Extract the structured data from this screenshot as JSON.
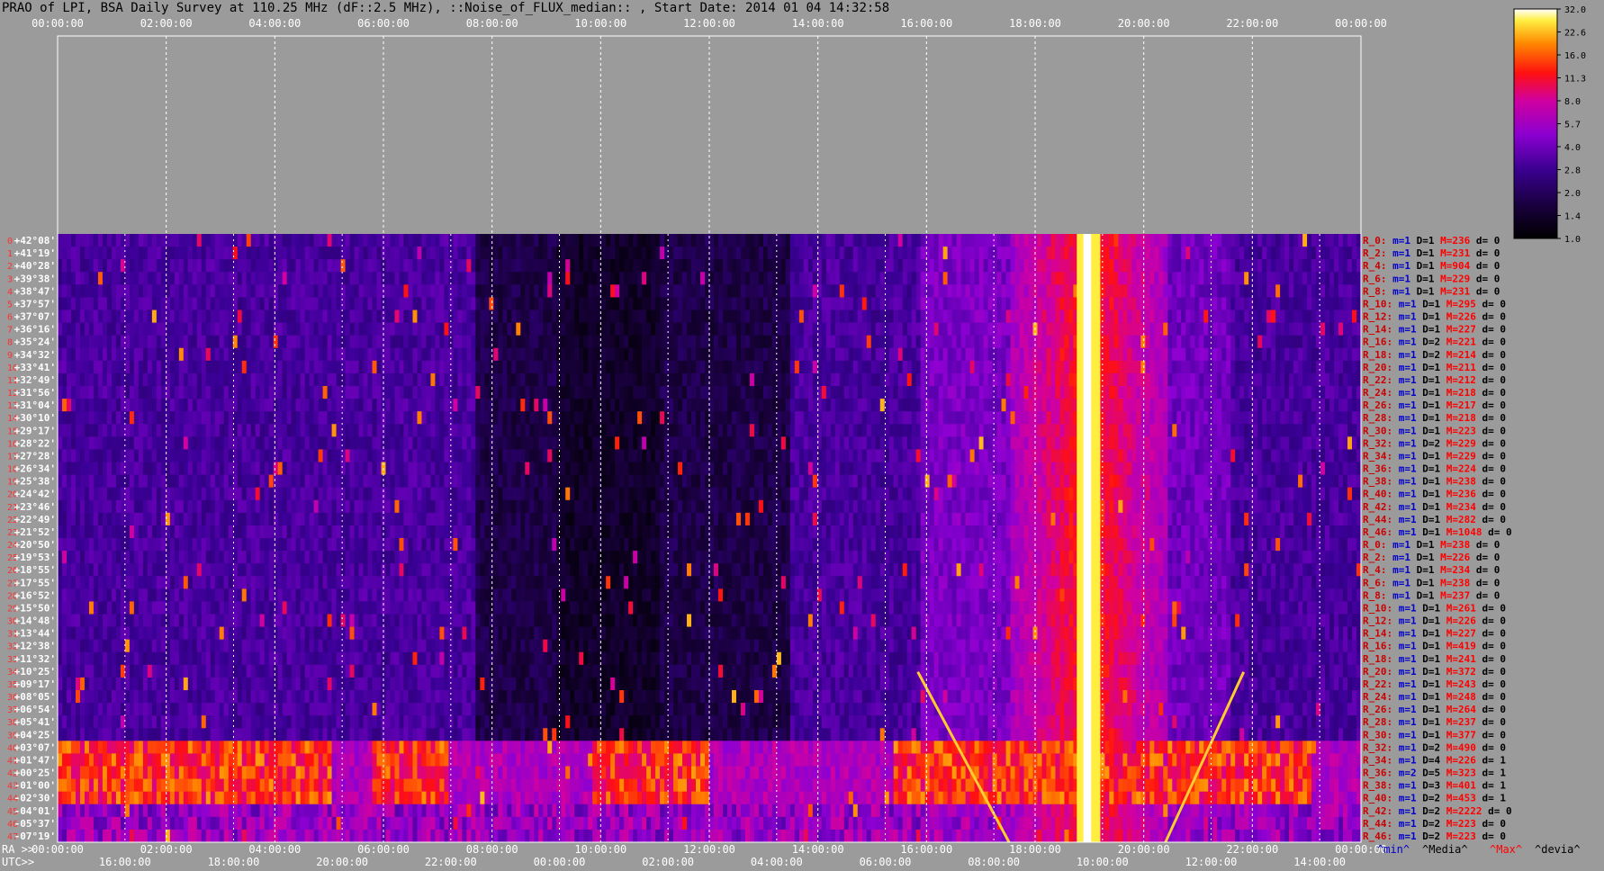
{
  "title": "PRAO of LPI, BSA Daily Survey at 110.25 MHz (dF::2.5 MHz), ::Noise_of_FLUX_median:: , Start Date: 2014 01 04 14:32:58",
  "chart_data": {
    "type": "heatmap",
    "title": "PRAO of LPI, BSA Daily Survey at 110.25 MHz (dF::2.5 MHz), ::Noise_of_FLUX_median:: , Start Date: 2014 01 04 14:32:58",
    "top_axis_ticks": [
      "00:00:00",
      "02:00:00",
      "04:00:00",
      "06:00:00",
      "08:00:00",
      "10:00:00",
      "12:00:00",
      "14:00:00",
      "16:00:00",
      "18:00:00",
      "20:00:00",
      "22:00:00",
      "00:00:00"
    ],
    "ra_axis_label": "RA >>",
    "ra_ticks": [
      "00:00:00",
      "02:00:00",
      "04:00:00",
      "06:00:00",
      "08:00:00",
      "10:00:00",
      "12:00:00",
      "14:00:00",
      "16:00:00",
      "18:00:00",
      "20:00:00",
      "22:00:00",
      "00:00:00"
    ],
    "utc_axis_label": "UTC>>",
    "utc_ticks": [
      "16:00:00",
      "18:00:00",
      "20:00:00",
      "22:00:00",
      "00:00:00",
      "02:00:00",
      "04:00:00",
      "06:00:00",
      "08:00:00",
      "10:00:00",
      "12:00:00",
      "14:00:00"
    ],
    "declinations": [
      "+42°08'",
      "+41°19'",
      "+40°28'",
      "+39°38'",
      "+38°47'",
      "+37°57'",
      "+37°07'",
      "+36°16'",
      "+35°24'",
      "+34°32'",
      "+33°41'",
      "+32°49'",
      "+31°56'",
      "+31°04'",
      "+30°10'",
      "+29°17'",
      "+28°22'",
      "+27°28'",
      "+26°34'",
      "+25°38'",
      "+24°42'",
      "+23°46'",
      "+22°49'",
      "+21°52'",
      "+20°50'",
      "+19°53'",
      "+18°55'",
      "+17°55'",
      "+16°52'",
      "+15°50'",
      "+14°48'",
      "+13°44'",
      "+12°38'",
      "+11°32'",
      "+10°25'",
      "+09°17'",
      "+08°05'",
      "+06°54'",
      "+05°41'",
      "+04°25'",
      "+03°07'",
      "+01°47'",
      "+00°25'",
      "-01°00'",
      "-02°30'",
      "-04°01'",
      "-05°37'",
      "-07°19'"
    ],
    "colorbar_ticks": [
      "32.0",
      "22.6",
      "16.0",
      "11.3",
      "8.0",
      "5.7",
      "4.0",
      "2.8",
      "2.0",
      "1.4",
      "1.0"
    ],
    "beam_stats": [
      {
        "r": "R_0:",
        "m": "m=1",
        "d": "D=1",
        "M": "M=236",
        "dv": "d= 0"
      },
      {
        "r": "R_2:",
        "m": "m=1",
        "d": "D=1",
        "M": "M=231",
        "dv": "d= 0"
      },
      {
        "r": "R_4:",
        "m": "m=1",
        "d": "D=1",
        "M": "M=904",
        "dv": "d= 0"
      },
      {
        "r": "R_6:",
        "m": "m=1",
        "d": "D=1",
        "M": "M=229",
        "dv": "d= 0"
      },
      {
        "r": "R_8:",
        "m": "m=1",
        "d": "D=1",
        "M": "M=231",
        "dv": "d= 0"
      },
      {
        "r": "R_10:",
        "m": "m=1",
        "d": "D=1",
        "M": "M=295",
        "dv": "d= 0"
      },
      {
        "r": "R_12:",
        "m": "m=1",
        "d": "D=1",
        "M": "M=226",
        "dv": "d= 0"
      },
      {
        "r": "R_14:",
        "m": "m=1",
        "d": "D=1",
        "M": "M=227",
        "dv": "d= 0"
      },
      {
        "r": "R_16:",
        "m": "m=1",
        "d": "D=2",
        "M": "M=221",
        "dv": "d= 0"
      },
      {
        "r": "R_18:",
        "m": "m=1",
        "d": "D=2",
        "M": "M=214",
        "dv": "d= 0"
      },
      {
        "r": "R_20:",
        "m": "m=1",
        "d": "D=1",
        "M": "M=211",
        "dv": "d= 0"
      },
      {
        "r": "R_22:",
        "m": "m=1",
        "d": "D=1",
        "M": "M=212",
        "dv": "d= 0"
      },
      {
        "r": "R_24:",
        "m": "m=1",
        "d": "D=1",
        "M": "M=218",
        "dv": "d= 0"
      },
      {
        "r": "R_26:",
        "m": "m=1",
        "d": "D=1",
        "M": "M=217",
        "dv": "d= 0"
      },
      {
        "r": "R_28:",
        "m": "m=1",
        "d": "D=1",
        "M": "M=218",
        "dv": "d= 0"
      },
      {
        "r": "R_30:",
        "m": "m=1",
        "d": "D=1",
        "M": "M=223",
        "dv": "d= 0"
      },
      {
        "r": "R_32:",
        "m": "m=1",
        "d": "D=2",
        "M": "M=229",
        "dv": "d= 0"
      },
      {
        "r": "R_34:",
        "m": "m=1",
        "d": "D=1",
        "M": "M=229",
        "dv": "d= 0"
      },
      {
        "r": "R_36:",
        "m": "m=1",
        "d": "D=1",
        "M": "M=224",
        "dv": "d= 0"
      },
      {
        "r": "R_38:",
        "m": "m=1",
        "d": "D=1",
        "M": "M=238",
        "dv": "d= 0"
      },
      {
        "r": "R_40:",
        "m": "m=1",
        "d": "D=1",
        "M": "M=236",
        "dv": "d= 0"
      },
      {
        "r": "R_42:",
        "m": "m=1",
        "d": "D=1",
        "M": "M=234",
        "dv": "d= 0"
      },
      {
        "r": "R_44:",
        "m": "m=1",
        "d": "D=1",
        "M": "M=282",
        "dv": "d= 0"
      },
      {
        "r": "R_46:",
        "m": "m=1",
        "d": "D=1",
        "M": "M=1048",
        "dv": "d= 0"
      },
      {
        "r": "R_0:",
        "m": "m=1",
        "d": "D=1",
        "M": "M=238",
        "dv": "d= 0"
      },
      {
        "r": "R_2:",
        "m": "m=1",
        "d": "D=1",
        "M": "M=226",
        "dv": "d= 0"
      },
      {
        "r": "R_4:",
        "m": "m=1",
        "d": "D=1",
        "M": "M=234",
        "dv": "d= 0"
      },
      {
        "r": "R_6:",
        "m": "m=1",
        "d": "D=1",
        "M": "M=238",
        "dv": "d= 0"
      },
      {
        "r": "R_8:",
        "m": "m=1",
        "d": "D=1",
        "M": "M=237",
        "dv": "d= 0"
      },
      {
        "r": "R_10:",
        "m": "m=1",
        "d": "D=1",
        "M": "M=261",
        "dv": "d= 0"
      },
      {
        "r": "R_12:",
        "m": "m=1",
        "d": "D=1",
        "M": "M=226",
        "dv": "d= 0"
      },
      {
        "r": "R_14:",
        "m": "m=1",
        "d": "D=1",
        "M": "M=227",
        "dv": "d= 0"
      },
      {
        "r": "R_16:",
        "m": "m=1",
        "d": "D=1",
        "M": "M=419",
        "dv": "d= 0"
      },
      {
        "r": "R_18:",
        "m": "m=1",
        "d": "D=1",
        "M": "M=241",
        "dv": "d= 0"
      },
      {
        "r": "R_20:",
        "m": "m=1",
        "d": "D=1",
        "M": "M=372",
        "dv": "d= 0"
      },
      {
        "r": "R_22:",
        "m": "m=1",
        "d": "D=1",
        "M": "M=243",
        "dv": "d= 0"
      },
      {
        "r": "R_24:",
        "m": "m=1",
        "d": "D=1",
        "M": "M=248",
        "dv": "d= 0"
      },
      {
        "r": "R_26:",
        "m": "m=1",
        "d": "D=1",
        "M": "M=264",
        "dv": "d= 0"
      },
      {
        "r": "R_28:",
        "m": "m=1",
        "d": "D=1",
        "M": "M=237",
        "dv": "d= 0"
      },
      {
        "r": "R_30:",
        "m": "m=1",
        "d": "D=1",
        "M": "M=377",
        "dv": "d= 0"
      },
      {
        "r": "R_32:",
        "m": "m=1",
        "d": "D=2",
        "M": "M=490",
        "dv": "d= 0"
      },
      {
        "r": "R_34:",
        "m": "m=1",
        "d": "D=4",
        "M": "M=226",
        "dv": "d= 1"
      },
      {
        "r": "R_36:",
        "m": "m=2",
        "d": "D=5",
        "M": "M=323",
        "dv": "d= 1"
      },
      {
        "r": "R_38:",
        "m": "m=1",
        "d": "D=3",
        "M": "M=401",
        "dv": "d= 1"
      },
      {
        "r": "R_40:",
        "m": "m=1",
        "d": "D=2",
        "M": "M=453",
        "dv": "d= 1"
      },
      {
        "r": "R_42:",
        "m": "m=1",
        "d": "D=2",
        "M": "M=2222",
        "dv": "d= 0"
      },
      {
        "r": "R_44:",
        "m": "m=1",
        "d": "D=2",
        "M": "M=223",
        "dv": "d= 0"
      },
      {
        "r": "R_46:",
        "m": "m=1",
        "d": "D=2",
        "M": "M=223",
        "dv": "d= 0"
      }
    ],
    "stats_legend": {
      "min": "^min^",
      "median": "^Media^",
      "max": "^Max^",
      "devia": "^devia^"
    },
    "colors": {
      "min": "#0000cc",
      "median": "#000000",
      "max": "#ff0000",
      "devia": "#000000",
      "beam": "#cc0000"
    }
  }
}
